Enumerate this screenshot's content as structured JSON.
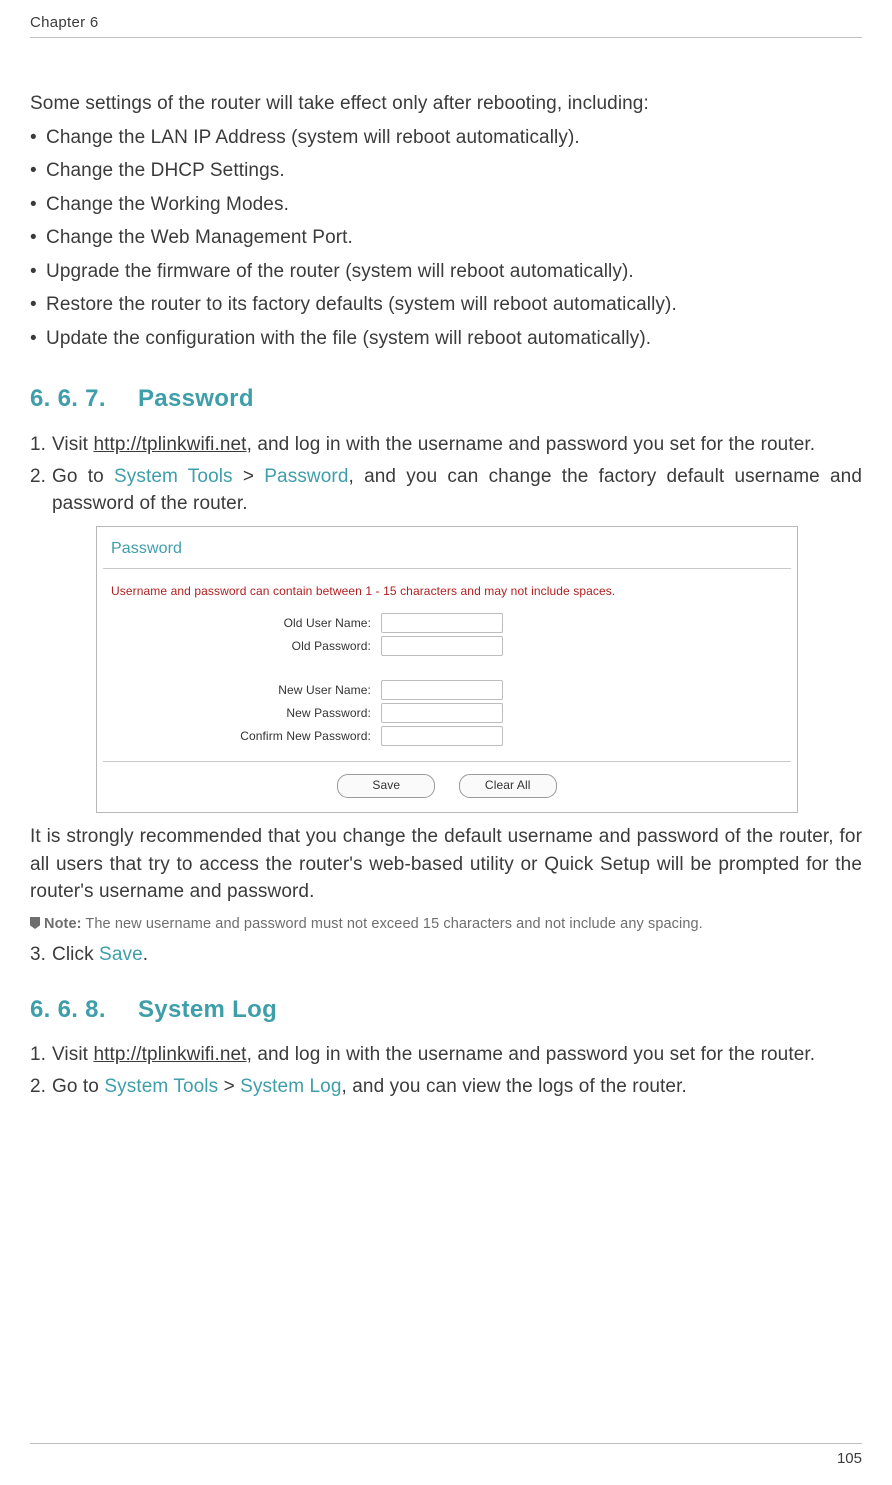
{
  "header": {
    "chapter": "Chapter 6"
  },
  "footer": {
    "page": "105"
  },
  "intro": "Some settings of the router will take effect only after rebooting, including:",
  "bullets": [
    "Change the LAN IP Address (system will reboot automatically).",
    "Change the DHCP Settings.",
    "Change the Working Modes.",
    "Change the Web Management Port.",
    "Upgrade the firmware of the router (system will reboot automatically).",
    "Restore the router to its factory defaults (system will reboot automatically).",
    "Update the configuration with the file (system will reboot automatically)."
  ],
  "section_password": {
    "num": "6. 6. 7.",
    "title": "Password",
    "steps": {
      "s1_pre": "Visit ",
      "s1_link": "http://tplinkwifi.net",
      "s1_post": ", and log in with the username and password you set for the router.",
      "s2_pre": "Go to ",
      "s2_nav1": "System Tools",
      "s2_sep": " > ",
      "s2_nav2": "Password",
      "s2_post": ", and you can change the factory default username and password of the router.",
      "s3_pre": "Click ",
      "s3_action": "Save",
      "s3_post": "."
    },
    "box": {
      "title": "Password",
      "warn": "Username and password can contain between 1 - 15 characters and may not include spaces.",
      "labels": {
        "old_user": "Old User Name:",
        "old_pass": "Old Password:",
        "new_user": "New User Name:",
        "new_pass": "New Password:",
        "confirm": "Confirm New Password:"
      },
      "buttons": {
        "save": "Save",
        "clear": "Clear All"
      }
    },
    "recommend": "It is strongly recommended that you change the default username and password of the router, for all users that try to access the router's web-based utility or Quick Setup will be prompted for the router's username and password.",
    "note_label": "Note:",
    "note_text": " The new username and password must not exceed 15 characters and not include any spacing."
  },
  "section_syslog": {
    "num": "6. 6. 8.",
    "title": "System Log",
    "steps": {
      "s1_pre": "Visit ",
      "s1_link": "http://tplinkwifi.net",
      "s1_post": ", and log in with the username and password you set for the router.",
      "s2_pre": "Go to ",
      "s2_nav1": "System Tools",
      "s2_sep": " > ",
      "s2_nav2": "System Log",
      "s2_post": ", and you can view the logs of the router."
    }
  }
}
